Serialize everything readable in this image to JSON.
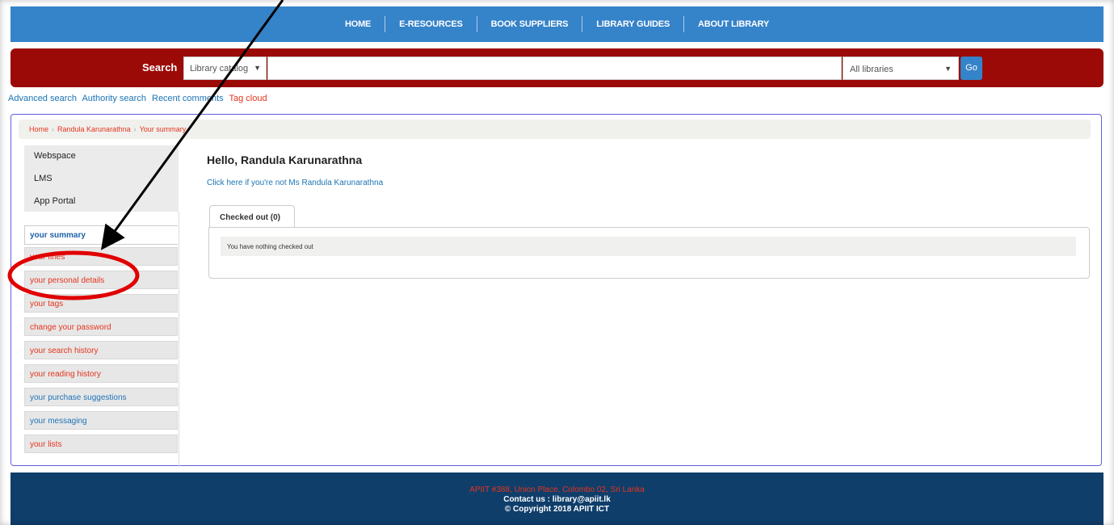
{
  "top_nav": {
    "items": [
      "HOME",
      "E-RESOURCES",
      "BOOK SUPPLIERS",
      "LIBRARY GUIDES",
      "ABOUT LIBRARY"
    ]
  },
  "search": {
    "label": "Search",
    "index_selected": "Library catalog",
    "query": "",
    "branch_selected": "All libraries",
    "go_label": "Go"
  },
  "more_searches": {
    "advanced": "Advanced search",
    "authority": "Authority search",
    "recent_comments": "Recent comments",
    "tag_cloud": "Tag cloud"
  },
  "breadcrumb": {
    "home": "Home",
    "user": "Randula Karunarathna",
    "current": "Your summary"
  },
  "quick_links": [
    "Webspace",
    "LMS",
    "App Portal"
  ],
  "user_nav": [
    {
      "label": "your summary",
      "active": true
    },
    {
      "label": "your fines",
      "active": false
    },
    {
      "label": "your personal details",
      "active": false
    },
    {
      "label": "your tags",
      "active": false
    },
    {
      "label": "change your password",
      "active": false
    },
    {
      "label": "your search history",
      "active": false
    },
    {
      "label": "your reading history",
      "active": false
    },
    {
      "label": "your purchase suggestions",
      "active": false
    },
    {
      "label": "your messaging",
      "active": false
    },
    {
      "label": "your lists",
      "active": false
    }
  ],
  "content": {
    "greeting": "Hello, Randula Karunarathna",
    "not_you_link": "Click here if you're not Ms Randula Karunarathna",
    "tab_label": "Checked out (0)",
    "empty_message": "You have nothing checked out"
  },
  "footer": {
    "address": "APIIT #388, Union Place, Colombo 02, Sri Lanka",
    "contact": "Contact us : library@apiit.lk",
    "copyright": "© Copyright 2018 APIIT ICT"
  },
  "colors": {
    "nav_blue": "#3583c9",
    "search_red": "#9b0a07",
    "link_red": "#e5341e",
    "footer_navy": "#0f3e6a",
    "annotation_red": "#e00000"
  }
}
